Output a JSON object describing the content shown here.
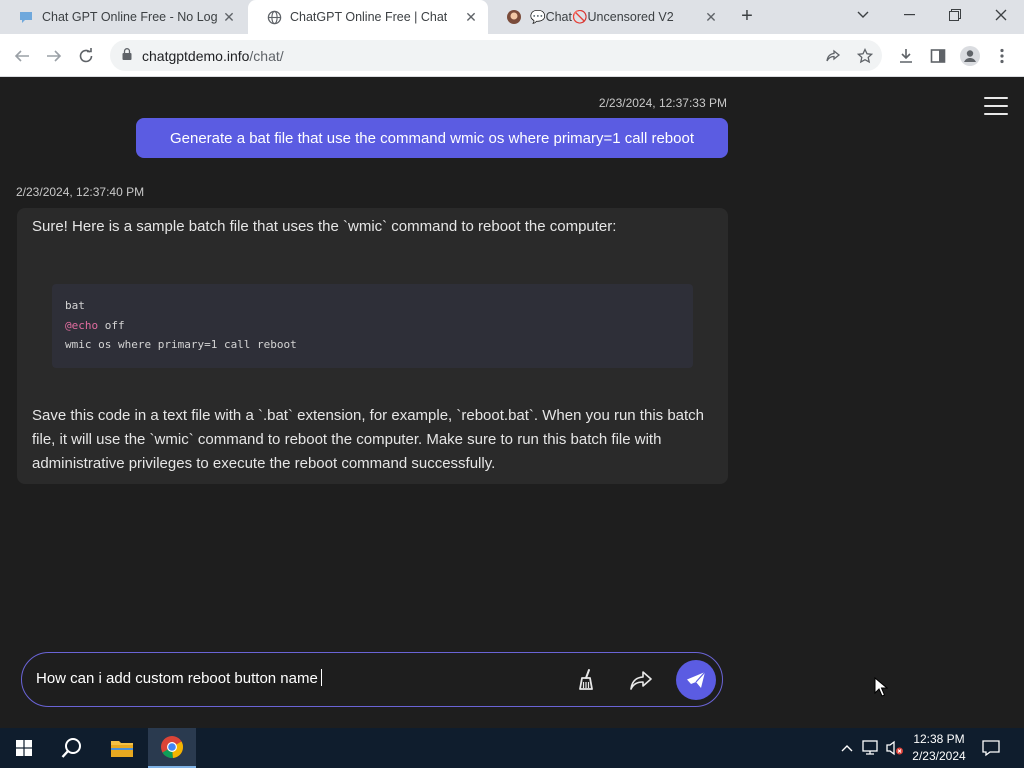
{
  "browser": {
    "tabs": [
      {
        "title": "Chat GPT Online Free - No Login",
        "active": false
      },
      {
        "title": "ChatGPT Online Free | Chat",
        "active": true
      },
      {
        "title": "💬Chat🚫Uncensored V2",
        "active": false
      }
    ],
    "url_host": "chatgptdemo.info",
    "url_path": "/chat/"
  },
  "chat": {
    "messages": [
      {
        "role": "user",
        "timestamp": "2/23/2024, 12:37:33 PM",
        "text": "Generate a bat file that use the command wmic os where primary=1 call reboot"
      },
      {
        "role": "assistant",
        "timestamp": "2/23/2024, 12:37:40 PM",
        "intro": "Sure! Here is a sample batch file that uses the `wmic` command to reboot the computer:",
        "code": {
          "lang": "bat",
          "line1_kw": "@echo",
          "line1_rest": " off",
          "line2": "wmic os where primary=1 call reboot"
        },
        "outro": "Save this code in a text file with a `.bat` extension, for example, `reboot.bat`. When you run this batch file, it will use the `wmic` command to reboot the computer. Make sure to run this batch file with administrative privileges to execute the reboot command successfully."
      }
    ],
    "composer": {
      "value": "How can i add custom reboot button name"
    }
  },
  "taskbar": {
    "time": "12:38 PM",
    "date": "2/23/2024"
  },
  "colors": {
    "accent": "#5b5ce2",
    "page_bg": "#1e1e1e",
    "bubble_bg": "#2a2a2a",
    "code_bg": "#2e2f38"
  }
}
